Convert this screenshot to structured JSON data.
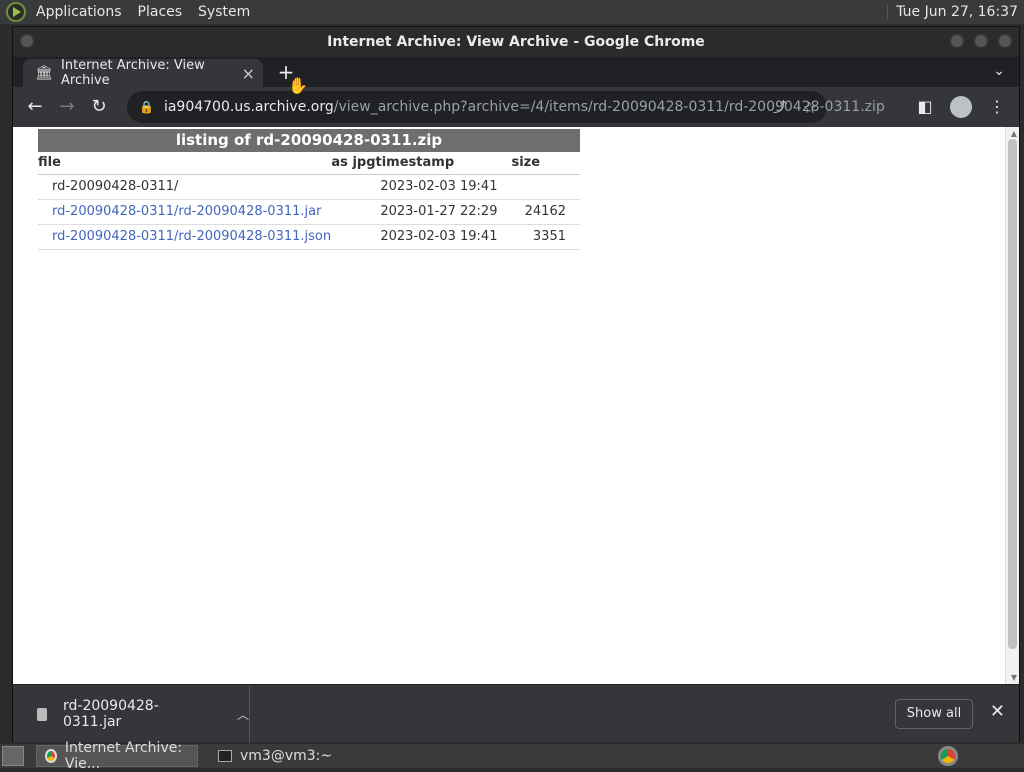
{
  "top_panel": {
    "menus": [
      "Applications",
      "Places",
      "System"
    ],
    "clock": "Tue Jun 27, 16:37"
  },
  "window": {
    "title": "Internet Archive: View Archive - Google Chrome"
  },
  "tab": {
    "title": "Internet Archive: View Archive",
    "close": "×",
    "new_tab": "+"
  },
  "omnibox": {
    "host": "ia904700.us.archive.org",
    "path": "/view_archive.php?archive=/4/items/rd-20090428-0311/rd-20090428-0311.zip"
  },
  "listing": {
    "caption": "listing of rd-20090428-0311.zip",
    "headers": [
      "file",
      "as jpg",
      "timestamp",
      "size"
    ],
    "rows": [
      {
        "name": "rd-20090428-0311/",
        "is_link": false,
        "timestamp": "2023-02-03 19:41",
        "size": ""
      },
      {
        "name": "rd-20090428-0311/rd-20090428-0311.jar",
        "is_link": true,
        "timestamp": "2023-01-27 22:29",
        "size": "24162"
      },
      {
        "name": "rd-20090428-0311/rd-20090428-0311.json",
        "is_link": true,
        "timestamp": "2023-02-03 19:41",
        "size": "3351"
      }
    ],
    "link_color": "#4466bb",
    "caption_bg": "#6e6e6e"
  },
  "download_bar": {
    "file": "rd-20090428-0311.jar",
    "show_all": "Show all"
  },
  "taskbar": {
    "tasks": [
      "Internet Archive: Vie...",
      "vm3@vm3:~"
    ]
  }
}
